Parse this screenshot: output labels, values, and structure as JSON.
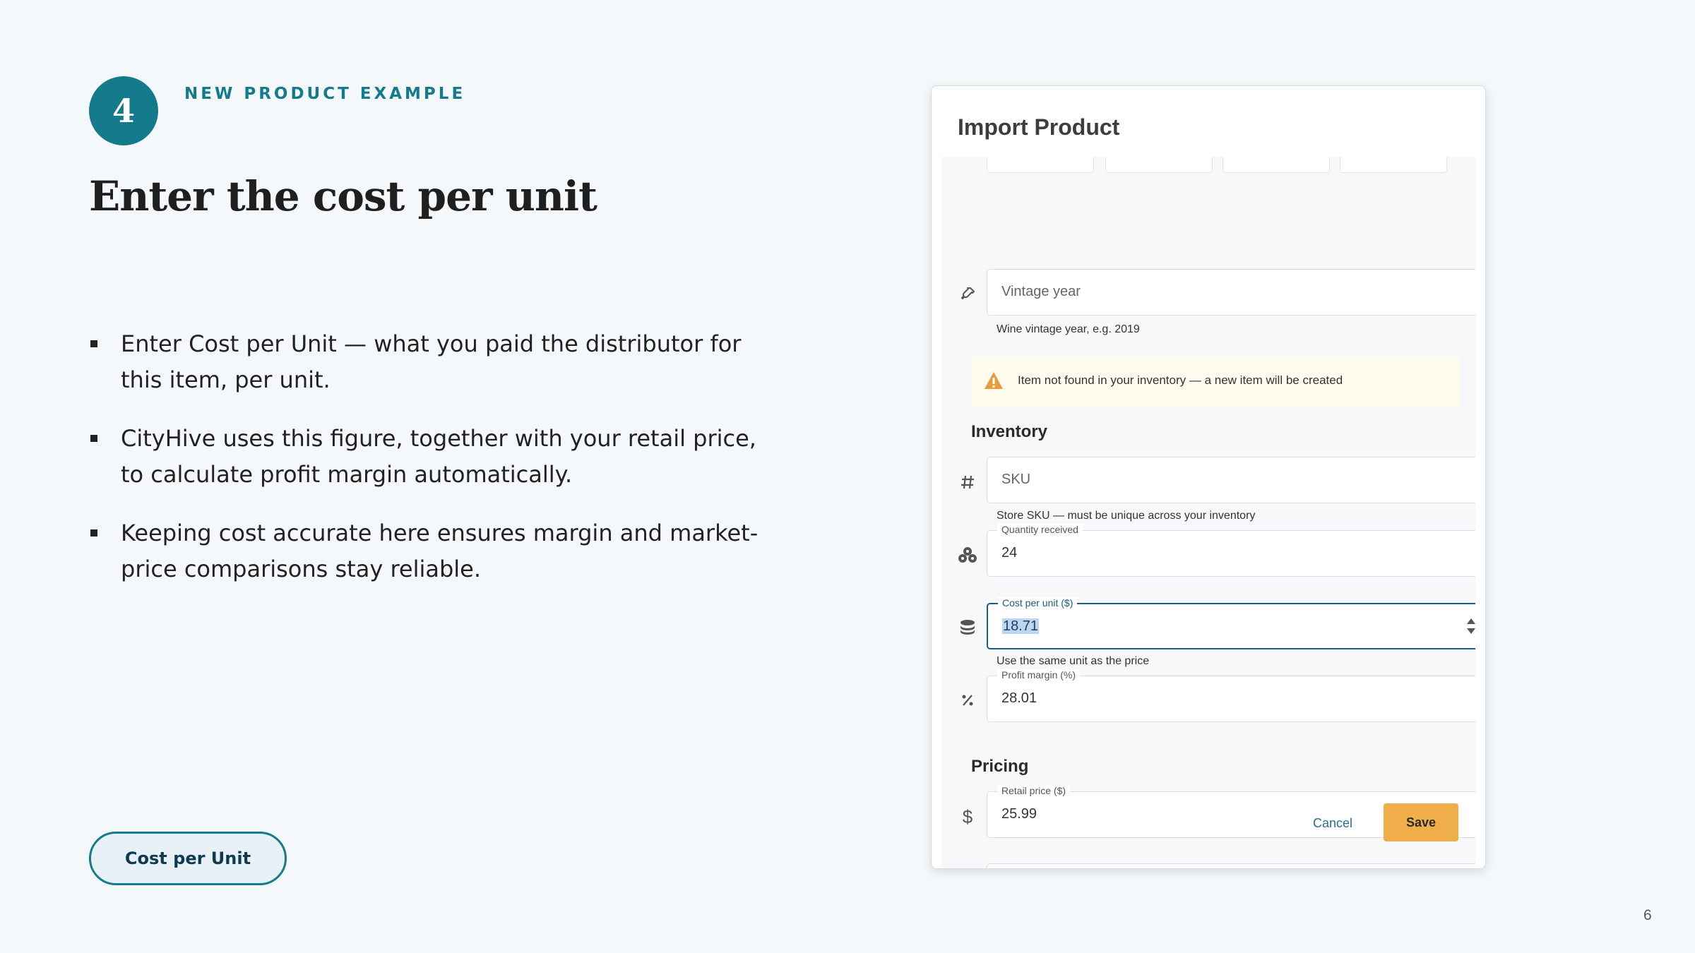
{
  "slide": {
    "step_number": "4",
    "eyebrow": "NEW PRODUCT EXAMPLE",
    "title": "Enter the cost per unit",
    "bullets": [
      "Enter Cost per Unit — what you paid the distributor for this item, per unit.",
      "CityHive uses this figure, together with your retail price, to calculate profit margin automatically.",
      "Keeping cost accurate here ensures margin and market-price comparisons stay reliable."
    ],
    "callout_label": "Cost per Unit",
    "page_number": "6"
  },
  "dialog": {
    "title": "Import Product",
    "vintage": {
      "placeholder": "Vintage year",
      "helper": "Wine vintage year, e.g. 2019",
      "icon": "wine-bottle-icon"
    },
    "notice": {
      "icon": "warning-icon",
      "color": "#e89a3c",
      "text": "Item not found in your inventory — a new item will be created"
    },
    "inventory": {
      "heading": "Inventory",
      "sku": {
        "placeholder": "SKU",
        "helper": "Store SKU — must be unique across your inventory",
        "icon": "hash-icon"
      },
      "quantity": {
        "label": "Quantity received",
        "value": "24",
        "icon": "boxes-icon"
      },
      "cost": {
        "label": "Cost per unit ($)",
        "value": "18.71",
        "helper": "Use the same unit as the price",
        "icon": "coins-icon"
      },
      "margin": {
        "label": "Profit margin (%)",
        "value": "28.01",
        "icon": "percent-icon"
      }
    },
    "pricing": {
      "heading": "Pricing",
      "retail": {
        "label": "Retail price ($)",
        "value": "25.99",
        "icon": "dollar-icon"
      }
    },
    "buttons": {
      "cancel": "Cancel",
      "save": "Save"
    }
  },
  "colors": {
    "accent": "#137b8c",
    "save_button": "#efae49",
    "focus_border": "#1a5c86"
  }
}
